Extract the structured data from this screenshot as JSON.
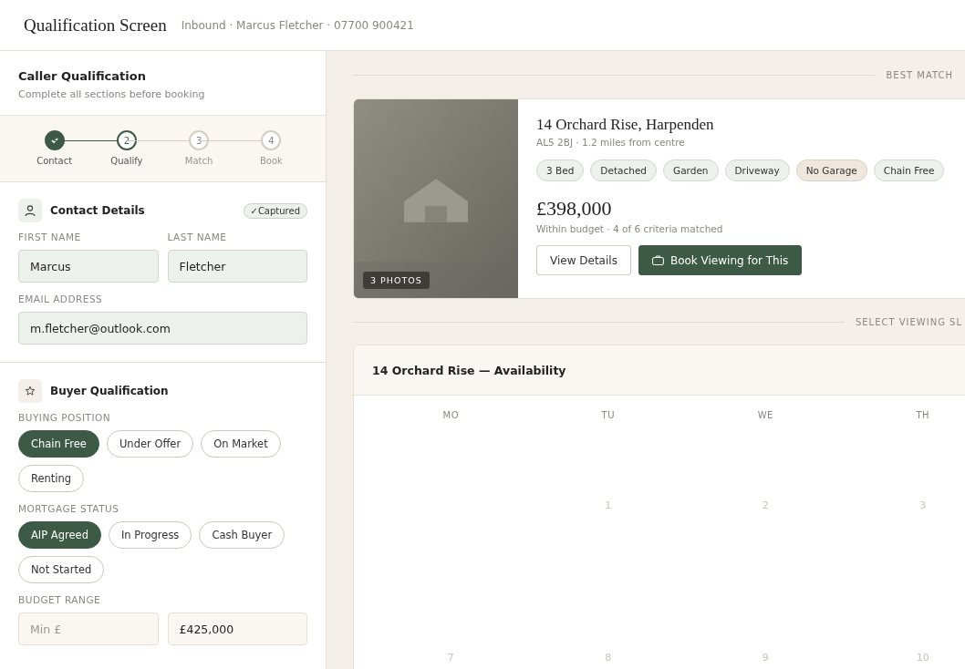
{
  "header": {
    "title": "Qualification Screen",
    "subtitle": "Inbound · Marcus Fletcher · 07700 900421"
  },
  "panel": {
    "title": "Caller Qualification",
    "subtitle": "Complete all sections before booking"
  },
  "steps": [
    {
      "label": "Contact",
      "completed": true,
      "selected": false
    },
    {
      "number": "2",
      "label": "Qualify",
      "completed": false,
      "selected": true
    },
    {
      "number": "3",
      "label": "Match",
      "completed": false,
      "selected": false
    },
    {
      "number": "4",
      "label": "Book",
      "completed": false,
      "selected": false
    }
  ],
  "contact": {
    "title": "Contact Details",
    "badge": "✓Captured",
    "fields": [
      {
        "label": "FIRST NAME",
        "value": "Marcus"
      },
      {
        "label": "LAST NAME",
        "value": "Fletcher"
      },
      {
        "label": "EMAIL ADDRESS",
        "value": "m.fletcher@outlook.com"
      }
    ]
  },
  "buyer": {
    "title": "Buyer Qualification",
    "groups": [
      {
        "label": "BUYING POSITION",
        "options": [
          {
            "label": "Chain Free",
            "selected": true
          },
          {
            "label": "Under Offer",
            "selected": false
          },
          {
            "label": "On Market",
            "selected": false
          },
          {
            "label": "Renting",
            "selected": false
          }
        ]
      },
      {
        "label": "MORTGAGE STATUS",
        "options": [
          {
            "label": "AIP Agreed",
            "selected": true
          },
          {
            "label": "In Progress",
            "selected": false
          },
          {
            "label": "Cash Buyer",
            "selected": false
          },
          {
            "label": "Not Started",
            "selected": false
          }
        ]
      }
    ],
    "budget": {
      "label": "BUDGET RANGE",
      "min": {
        "placeholder": "Min £"
      },
      "max": {
        "value": "£425,000"
      }
    }
  },
  "best_match": {
    "label": "BEST MATCH",
    "photos": "3 PHOTOS",
    "address": "14 Orchard Rise, Harpenden",
    "location": "AL5 2BJ · 1.2 miles from centre",
    "tags": [
      {
        "label": "3 Bed",
        "matched": true
      },
      {
        "label": "Detached",
        "matched": true
      },
      {
        "label": "Garden",
        "matched": true
      },
      {
        "label": "Driveway",
        "matched": true
      },
      {
        "label": "No Garage",
        "matched": false
      },
      {
        "label": "Chain Free",
        "matched": true
      }
    ],
    "price": "£398,000",
    "note": "Within budget · 4 of 6 criteria matched",
    "buttons": [
      "View Details",
      "Book Viewing for This"
    ]
  },
  "viewing": {
    "label": "SELECT VIEWING SL",
    "title": "14 Orchard Rise — Availability",
    "weekdays": [
      "MO",
      "TU",
      "WE",
      "TH"
    ],
    "weeks": [
      {
        "leading_blank": true,
        "days": [
          "1",
          "2",
          "3"
        ]
      },
      {
        "days": [
          "7",
          "8",
          "9",
          "10"
        ]
      }
    ]
  }
}
